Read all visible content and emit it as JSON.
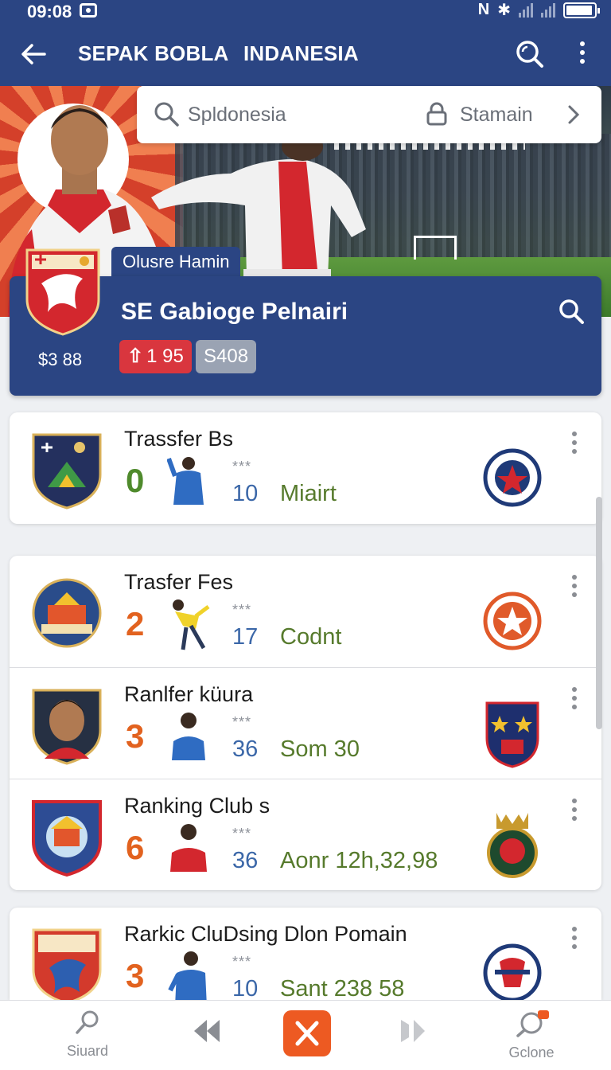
{
  "status": {
    "time": "09:08"
  },
  "appbar": {
    "title_left": "SEPAK BOBLA",
    "title_right": "INDANESIA"
  },
  "search": {
    "value": "Spldonesia",
    "right_label": "Stamain"
  },
  "banner": {
    "tag": "Olusre Hamin",
    "name": "SE Gabioge Pelnairi",
    "price": "$3 88",
    "change": "1 95",
    "badge": "S408"
  },
  "rows": [
    {
      "name": "Trassfer Bs",
      "rank": "0",
      "rank_color": "#4f8a2c",
      "stars": "***",
      "number": "10",
      "meta": "Miairt",
      "crest": "#24305e",
      "opp": "#1f3a78"
    },
    {
      "name": "Trasfer Fes",
      "rank": "2",
      "rank_color": "#e2621f",
      "stars": "***",
      "number": "17",
      "meta": "Codnt",
      "crest": "#2a4c8a",
      "opp": "#e05a2a"
    },
    {
      "name": "Ranlfer küura",
      "rank": "3",
      "rank_color": "#e2621f",
      "stars": "***",
      "number": "36",
      "meta": "Som 30",
      "crest": "#263043",
      "opp": "#1e2f6e"
    },
    {
      "name": "Ranking Club s",
      "rank": "6",
      "rank_color": "#e2621f",
      "stars": "***",
      "number": "36",
      "meta": "Aonr 12h,32,98",
      "crest": "#2d4c94",
      "opp": "#1e4a2e"
    },
    {
      "name": "Rarkic CluDsing Dlon Pomain",
      "rank": "3",
      "rank_color": "#e2621f",
      "stars": "***",
      "number": "10",
      "meta": "Sant 238 58",
      "crest": "#d33a2c",
      "opp": "#1f3a78"
    }
  ],
  "bottom_nav": {
    "left_label": "Siuard",
    "right_label": "Gclone"
  },
  "colors": {
    "primary": "#2b4583",
    "accent": "#ed5a22",
    "up": "#d9363e"
  }
}
